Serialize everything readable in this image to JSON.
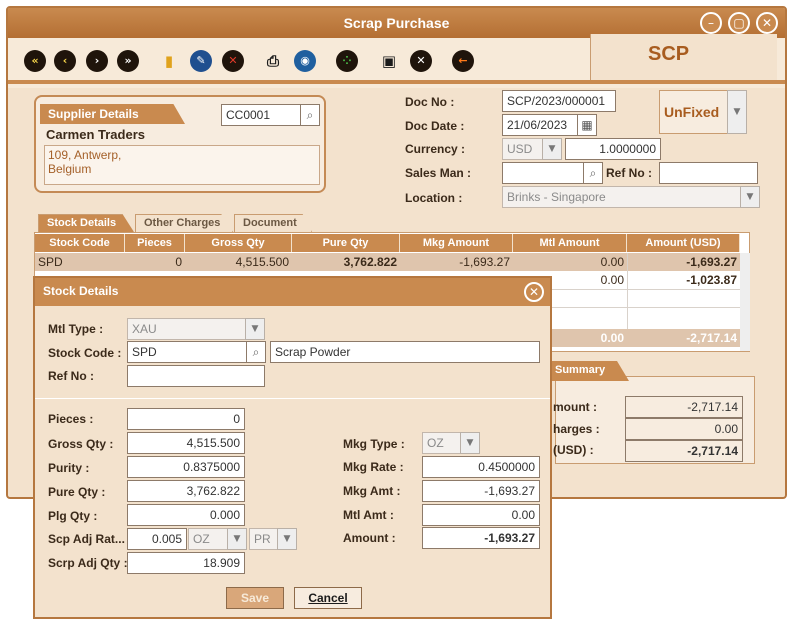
{
  "window": {
    "title": "Scrap Purchase",
    "screen_code": "SCP"
  },
  "toolbar": {
    "icons": [
      "first-icon",
      "previous-icon",
      "next-icon",
      "last-icon",
      "folder-icon",
      "edit-icon",
      "delete-icon",
      "print-icon",
      "search-icon",
      "grid-icon",
      "save-icon",
      "cancel-icon",
      "exit-icon"
    ]
  },
  "supplier": {
    "tab_label": "Supplier Details",
    "code": "CC0001",
    "name": "Carmen Traders",
    "address_line1": "109, Antwerp,",
    "address_line2": "Belgium"
  },
  "doc": {
    "doc_no_label": "Doc No :",
    "doc_no": "SCP/2023/000001",
    "doc_date_label": "Doc Date :",
    "doc_date": "21/06/2023",
    "currency_label": "Currency :",
    "currency": "USD",
    "rate": "1.0000000",
    "sales_man_label": "Sales Man :",
    "sales_man": "",
    "ref_no_label": "Ref No :",
    "ref_no": "",
    "location_label": "Location :",
    "location": "Brinks - Singapore",
    "fix_status": "UnFixed"
  },
  "tabs": [
    "Stock Details",
    "Other Charges",
    "Document"
  ],
  "grid": {
    "headers": [
      "Stock Code",
      "Pieces",
      "Gross Qty",
      "Pure Qty",
      "Mkg Amount",
      "Mtl Amount",
      "Amount (USD)"
    ],
    "rows": [
      [
        "SPD",
        "0",
        "4,515.500",
        "3,762.822",
        "-1,693.27",
        "0.00",
        "-1,693.27"
      ],
      [
        "",
        "",
        "",
        "",
        "",
        "0.00",
        "-1,023.87"
      ]
    ],
    "totals": {
      "mtl_amount": "0.00",
      "amount": "-2,717.14"
    }
  },
  "summary": {
    "tab_label": "Summary",
    "rows": [
      {
        "label": "mount :",
        "value": "-2,717.14"
      },
      {
        "label": "harges :",
        "value": "0.00"
      },
      {
        "label": "(USD) :",
        "value": "-2,717.14"
      }
    ]
  },
  "dialog": {
    "title": "Stock Details",
    "mtl_type_label": "Mtl Type :",
    "mtl_type": "XAU",
    "stock_code_label": "Stock Code :",
    "stock_code": "SPD",
    "stock_description": "Scrap Powder",
    "ref_no_label": "Ref No :",
    "ref_no": "",
    "pieces_label": "Pieces :",
    "pieces": "0",
    "gross_qty_label": "Gross Qty :",
    "gross_qty": "4,515.500",
    "purity_label": "Purity :",
    "purity": "0.8375000",
    "pure_qty_label": "Pure Qty :",
    "pure_qty": "3,762.822",
    "plg_qty_label": "Plg Qty :",
    "plg_qty": "0.000",
    "scp_adj_rate_label": "Scp Adj Rat...",
    "scp_adj_rate": "0.005",
    "scp_adj_unit1": "OZ",
    "scp_adj_unit2": "PR",
    "scrp_adj_qty_label": "Scrp Adj Qty :",
    "scrp_adj_qty": "18.909",
    "mkg_type_label": "Mkg Type :",
    "mkg_type": "OZ",
    "mkg_rate_label": "Mkg Rate :",
    "mkg_rate": "0.4500000",
    "mkg_amt_label": "Mkg Amt :",
    "mkg_amt": "-1,693.27",
    "mtl_amt_label": "Mtl Amt :",
    "mtl_amt": "0.00",
    "amount_label": "Amount :",
    "amount": "-1,693.27",
    "save_label": "Save",
    "cancel_label": "Cancel"
  },
  "colors": {
    "accent": "#c98a4f",
    "panel": "#f3e2cd",
    "brand_text": "#a85c1f"
  }
}
